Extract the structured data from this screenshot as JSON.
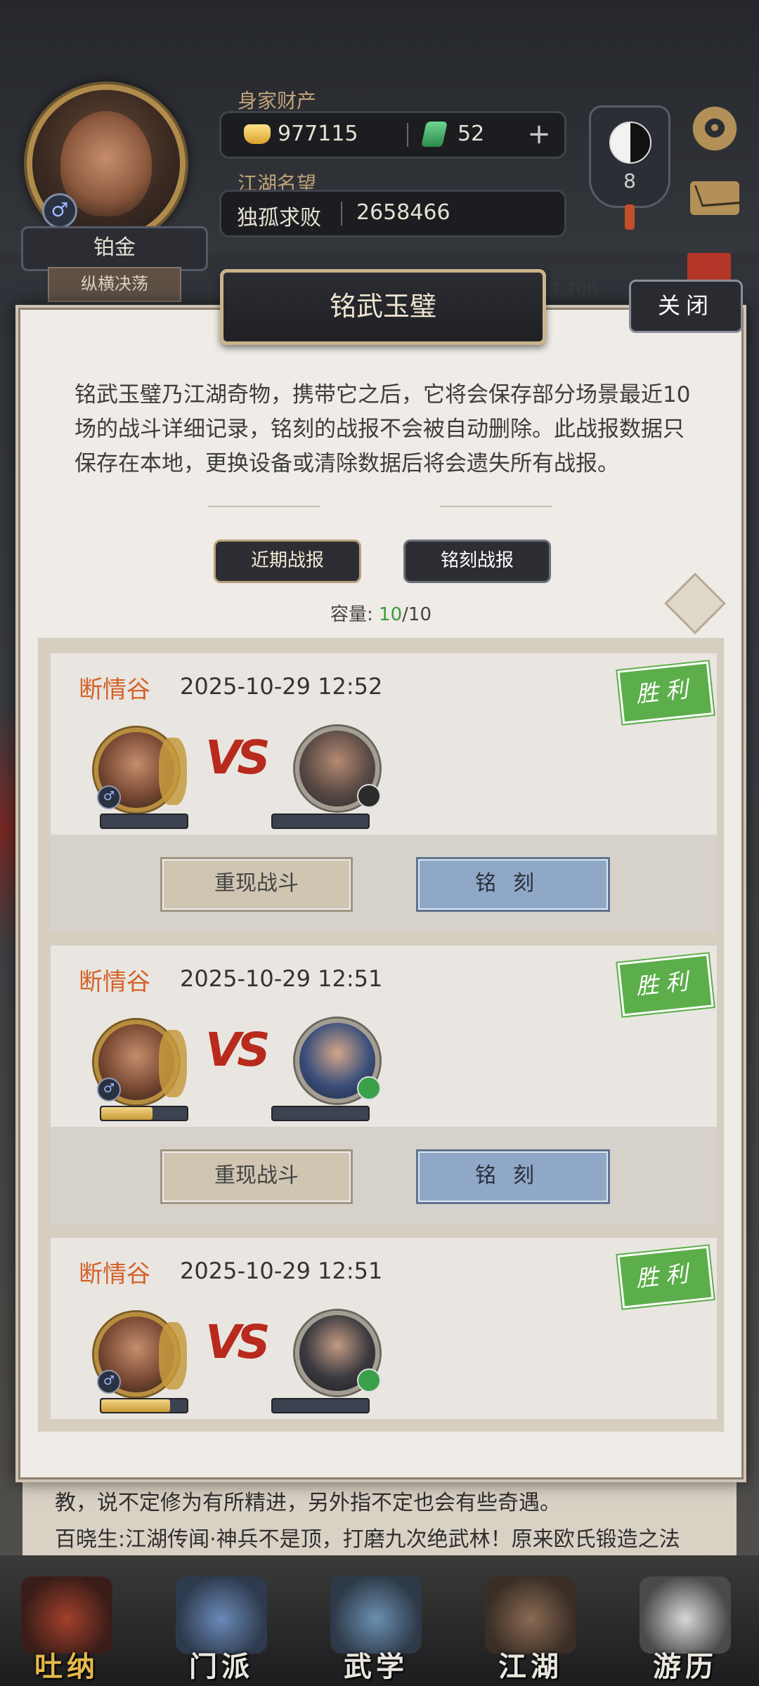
{
  "header": {
    "wealth_label": "身家财产",
    "gold": "977115",
    "jade": "52",
    "plus": "+",
    "fame_label": "江湖名望",
    "fame_title": "独孤求败",
    "fame_value": "2658466",
    "rank": "铂金",
    "title_badge": "纵横决荡",
    "gender_symbol": "♂",
    "taiji_level": "8"
  },
  "background": {
    "peek_top": "胜: 7,700"
  },
  "modal": {
    "title": "铭武玉璧",
    "close_label": "关闭",
    "description": "铭武玉璧乃江湖奇物，携带它之后，它将会保存部分场景最近10场的战斗详细记录，铭刻的战报不会被自动删除。此战报数据只保存在本地，更换设备或清除数据后将会遗失所有战报。",
    "tabs": {
      "recent": "近期战报",
      "inscribed": "铭刻战报"
    },
    "capacity": {
      "label": "容量: ",
      "used": "10",
      "total": "/10"
    },
    "records": [
      {
        "location": "断情谷",
        "time": "2025-10-29 12:52",
        "result": "胜利",
        "my_hp": 0.0,
        "foe_hp": 0.0,
        "replay_label": "重现战斗",
        "inscribe_label": "铭刻"
      },
      {
        "location": "断情谷",
        "time": "2025-10-29 12:51",
        "result": "胜利",
        "my_hp": 0.6,
        "foe_hp": 0.0,
        "replay_label": "重现战斗",
        "inscribe_label": "铭刻"
      },
      {
        "location": "断情谷",
        "time": "2025-10-29 12:51",
        "result": "胜利",
        "my_hp": 0.8,
        "foe_hp": 0.0
      }
    ]
  },
  "peek": {
    "line1": "教，说不定修为有所精进，另外指不定也会有些奇遇。",
    "line2": "百晓生:江湖传闻·神兵不是顶，打磨九次绝武林！原来欧氏锻造之法"
  },
  "nav": [
    {
      "label": "吐纳",
      "active": true
    },
    {
      "label": "门派",
      "active": false
    },
    {
      "label": "武学",
      "active": false
    },
    {
      "label": "江湖",
      "active": false
    },
    {
      "label": "游历",
      "active": false
    }
  ],
  "colors": {
    "win_green": "#5cae4b",
    "location_orange": "#d4622a",
    "capacity_green": "#3a9d3a",
    "inscribe_blue": "#8fa8c8"
  },
  "icons": [
    "gold-ingot-icon",
    "jade-icon",
    "taiji-icon",
    "gear-icon",
    "mail-icon",
    "sync-icon",
    "male-icon"
  ]
}
